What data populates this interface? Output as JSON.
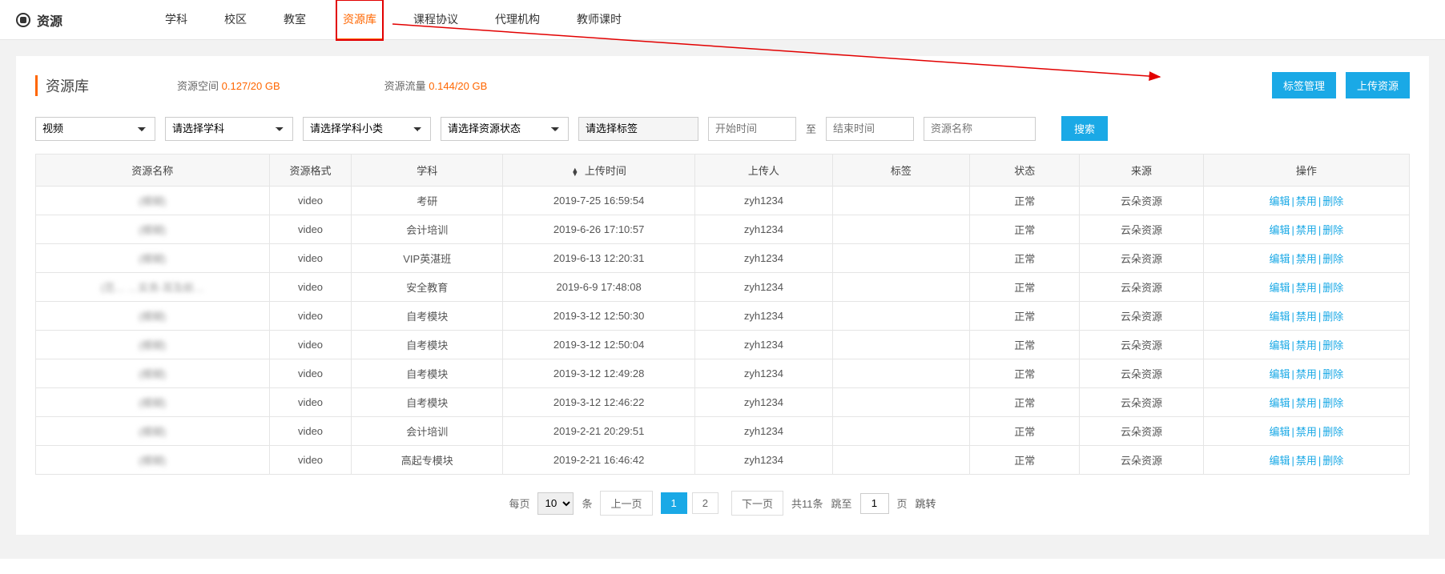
{
  "header": {
    "logo_text": "资源",
    "tabs": [
      "学科",
      "校区",
      "教室",
      "资源库",
      "课程协议",
      "代理机构",
      "教师课时"
    ],
    "active_index": 3
  },
  "panel": {
    "title": "资源库",
    "space_label": "资源空间",
    "space_value": "0.127/20 GB",
    "flow_label": "资源流量",
    "flow_value": "0.144/20 GB",
    "btn_tag_manage": "标签管理",
    "btn_upload": "上传资源"
  },
  "filters": {
    "type": "视频",
    "subject": "请选择学科",
    "sub_subject": "请选择学科小类",
    "status": "请选择资源状态",
    "tag": "请选择标签",
    "start_ph": "开始时间",
    "to": "至",
    "end_ph": "结束时间",
    "name_ph": "资源名称",
    "search": "搜索"
  },
  "table": {
    "headers": [
      "资源名称",
      "资源格式",
      "学科",
      "上传时间",
      "上传人",
      "标签",
      "状态",
      "来源",
      "操作"
    ],
    "rows": [
      {
        "name": "(模糊)",
        "fmt": "video",
        "subject": "考研",
        "time": "2019-7-25 16:59:54",
        "uploader": "zyh1234",
        "tag": "",
        "status": "正常",
        "source": "云朵资源"
      },
      {
        "name": "(模糊)",
        "fmt": "video",
        "subject": "会计培训",
        "time": "2019-6-26 17:10:57",
        "uploader": "zyh1234",
        "tag": "",
        "status": "正常",
        "source": "云朵资源"
      },
      {
        "name": "(模糊)",
        "fmt": "video",
        "subject": "VIP英湛班",
        "time": "2019-6-13 12:20:31",
        "uploader": "zyh1234",
        "tag": "",
        "status": "正常",
        "source": "云朵资源"
      },
      {
        "name": "(范… …实务-耳及前…",
        "fmt": "video",
        "subject": "安全教育",
        "time": "2019-6-9 17:48:08",
        "uploader": "zyh1234",
        "tag": "",
        "status": "正常",
        "source": "云朵资源"
      },
      {
        "name": "(模糊)",
        "fmt": "video",
        "subject": "自考模块",
        "time": "2019-3-12 12:50:30",
        "uploader": "zyh1234",
        "tag": "",
        "status": "正常",
        "source": "云朵资源"
      },
      {
        "name": "(模糊)",
        "fmt": "video",
        "subject": "自考模块",
        "time": "2019-3-12 12:50:04",
        "uploader": "zyh1234",
        "tag": "",
        "status": "正常",
        "source": "云朵资源"
      },
      {
        "name": "(模糊)",
        "fmt": "video",
        "subject": "自考模块",
        "time": "2019-3-12 12:49:28",
        "uploader": "zyh1234",
        "tag": "",
        "status": "正常",
        "source": "云朵资源"
      },
      {
        "name": "(模糊)",
        "fmt": "video",
        "subject": "自考模块",
        "time": "2019-3-12 12:46:22",
        "uploader": "zyh1234",
        "tag": "",
        "status": "正常",
        "source": "云朵资源"
      },
      {
        "name": "(模糊)",
        "fmt": "video",
        "subject": "会计培训",
        "time": "2019-2-21 20:29:51",
        "uploader": "zyh1234",
        "tag": "",
        "status": "正常",
        "source": "云朵资源"
      },
      {
        "name": "(模糊)",
        "fmt": "video",
        "subject": "高起专模块",
        "time": "2019-2-21 16:46:42",
        "uploader": "zyh1234",
        "tag": "",
        "status": "正常",
        "source": "云朵资源"
      }
    ],
    "actions": {
      "edit": "编辑",
      "disable": "禁用",
      "delete": "删除"
    }
  },
  "pager": {
    "per_page_label": "每页",
    "per_page_value": "10",
    "per_page_unit": "条",
    "prev": "上一页",
    "pages": [
      "1",
      "2"
    ],
    "current": 1,
    "next": "下一页",
    "total": "共11条",
    "jump_label": "跳至",
    "jump_value": "1",
    "jump_unit": "页",
    "jump_btn": "跳转"
  }
}
